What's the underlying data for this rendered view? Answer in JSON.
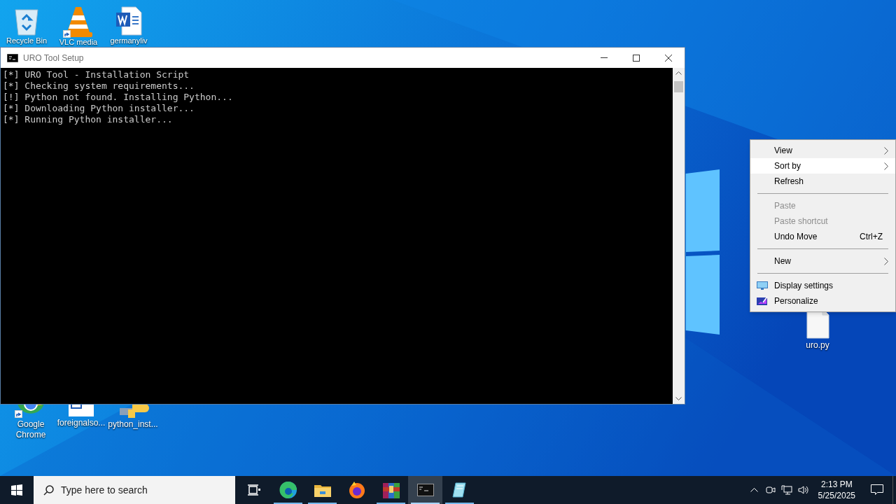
{
  "desktop_icons": [
    {
      "label": "Recycle Bin",
      "kind": "recycle",
      "shortcut": false
    },
    {
      "label": "VLC media",
      "kind": "cone",
      "shortcut": true
    },
    {
      "label": "germanyliv",
      "kind": "word",
      "shortcut": false
    },
    {
      "label": "Google\nChrome",
      "kind": "chrome",
      "shortcut": true
    },
    {
      "label": "foreignalso...",
      "kind": "doc",
      "shortcut": false
    },
    {
      "label": "python_inst...",
      "kind": "python",
      "shortcut": false
    },
    {
      "label": "uro.py",
      "kind": "file",
      "shortcut": false
    }
  ],
  "console_window": {
    "title": "URO Tool Setup",
    "lines": [
      "[*] URO Tool - Installation Script",
      "[*] Checking system requirements...",
      "[!] Python not found. Installing Python...",
      "[*] Downloading Python installer...",
      "[*] Running Python installer..."
    ]
  },
  "context_menu": [
    {
      "kind": "item",
      "label": "View",
      "submenu": true,
      "disabled": false,
      "selected": false
    },
    {
      "kind": "item",
      "label": "Sort by",
      "submenu": true,
      "disabled": false,
      "selected": true
    },
    {
      "kind": "item",
      "label": "Refresh",
      "submenu": false,
      "disabled": false,
      "selected": false
    },
    {
      "kind": "separator"
    },
    {
      "kind": "item",
      "label": "Paste",
      "submenu": false,
      "disabled": true,
      "selected": false
    },
    {
      "kind": "item",
      "label": "Paste shortcut",
      "submenu": false,
      "disabled": true,
      "selected": false
    },
    {
      "kind": "item",
      "label": "Undo Move",
      "shortcut": "Ctrl+Z",
      "submenu": false,
      "disabled": false,
      "selected": false
    },
    {
      "kind": "separator"
    },
    {
      "kind": "item",
      "label": "New",
      "submenu": true,
      "disabled": false,
      "selected": false
    },
    {
      "kind": "separator"
    },
    {
      "kind": "item",
      "label": "Display settings",
      "submenu": false,
      "disabled": false,
      "selected": false
    },
    {
      "kind": "item",
      "label": "Personalize",
      "submenu": false,
      "disabled": false,
      "selected": false
    }
  ],
  "taskbar": {
    "search": {
      "placeholder": "Type here to search"
    },
    "apps": [
      {
        "kind": "taskview",
        "running": false,
        "active": false
      },
      {
        "kind": "edge",
        "running": true,
        "active": false
      },
      {
        "kind": "folder",
        "running": true,
        "active": false
      },
      {
        "kind": "firefox",
        "running": false,
        "active": false
      },
      {
        "kind": "archive",
        "running": true,
        "active": false
      },
      {
        "kind": "console",
        "running": true,
        "active": true
      },
      {
        "kind": "notepad",
        "running": true,
        "active": false
      }
    ],
    "time": "2:13 PM",
    "date": "5/25/2025"
  }
}
